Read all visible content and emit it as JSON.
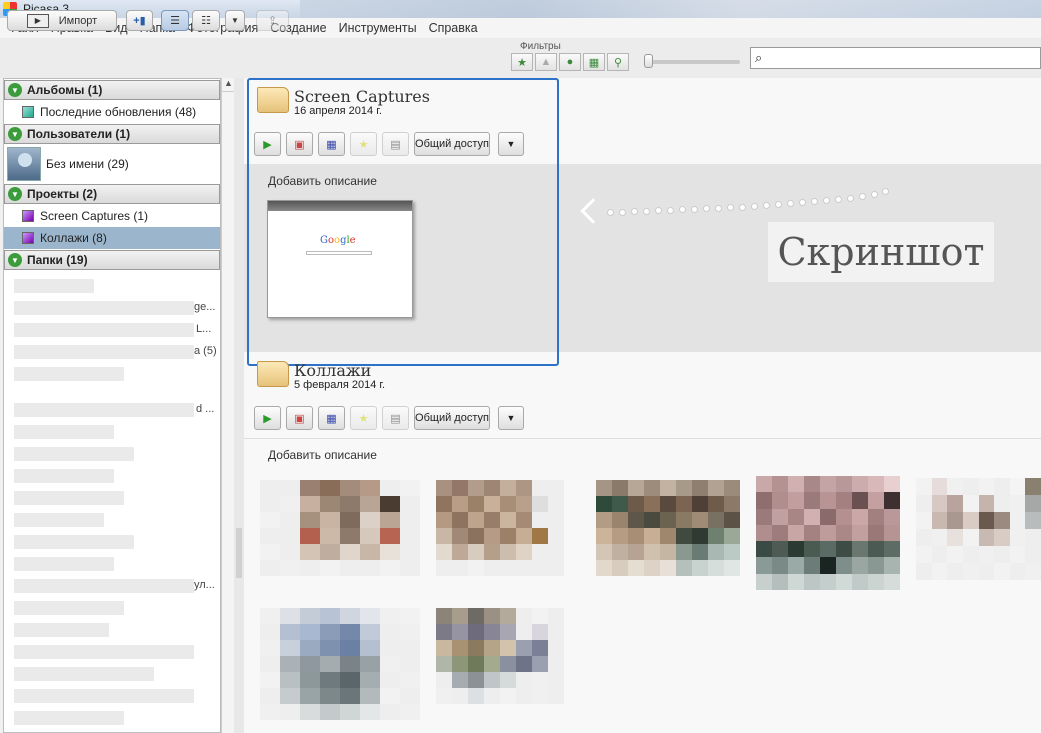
{
  "window": {
    "title": "Picasa 3"
  },
  "menu": [
    "Файл",
    "Правка",
    "Вид",
    "Папка",
    "Фотография",
    "Создание",
    "Инструменты",
    "Справка"
  ],
  "toolbar": {
    "import_label": "Импорт",
    "filters_label": "Фильтры",
    "search_placeholder": ""
  },
  "sidebar": {
    "albums": {
      "header": "Альбомы (1)",
      "items": [
        {
          "label": "Последние обновления (48)"
        }
      ]
    },
    "users": {
      "header": "Пользователи (1)",
      "items": [
        {
          "label": "Без имени (29)"
        }
      ]
    },
    "projects": {
      "header": "Проекты (2)",
      "items": [
        {
          "label": "Screen Captures (1)"
        },
        {
          "label": "Коллажи (8)"
        }
      ]
    },
    "folders": {
      "header": "Папки (19)",
      "partial_labels": [
        "ge...",
        "L...",
        "a (5)",
        "d ...",
        "ул..."
      ]
    }
  },
  "main": {
    "albums": [
      {
        "title": "Screen Captures",
        "date": "16 апреля 2014 г.",
        "share_label": "Общий доступ",
        "description_placeholder": "Добавить описание"
      },
      {
        "title": "Коллажи",
        "date": "5 февраля 2014 г.",
        "share_label": "Общий доступ",
        "description_placeholder": "Добавить описание"
      }
    ],
    "annotation": "Скриншот"
  }
}
